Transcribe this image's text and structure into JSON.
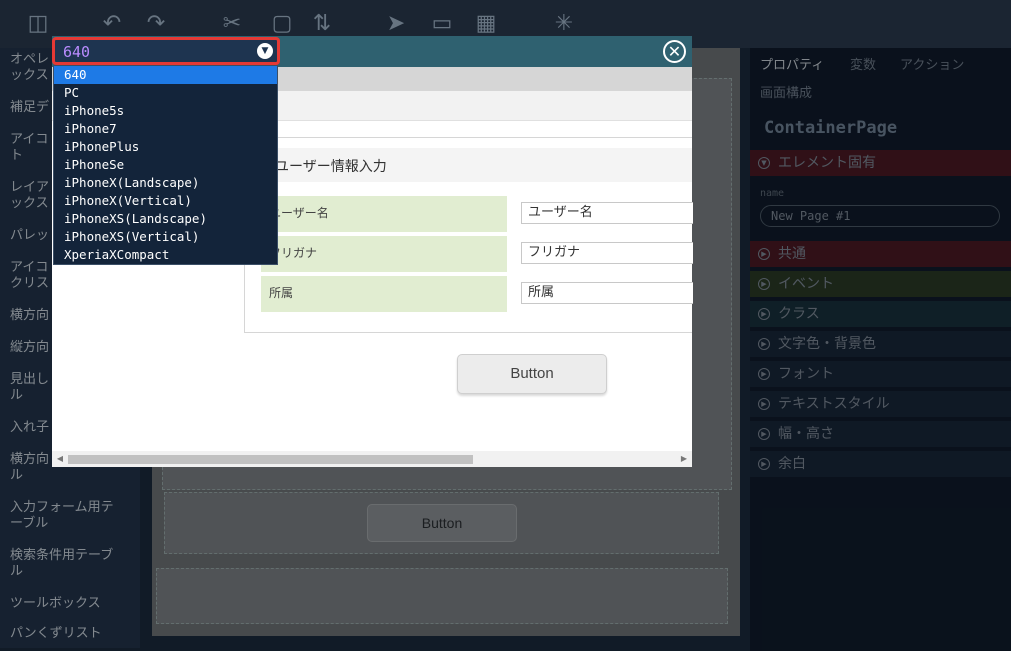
{
  "colors": {
    "modal_header": "#2f6170",
    "dropdown_bg": "#13243a",
    "dropdown_selected": "#1e7ae6",
    "select_border": "#e53935",
    "select_value": "#b98cff",
    "form_label_bg": "#e1edd1",
    "section_active": "#5a1e2a"
  },
  "toolbar": {
    "icons": [
      "database-icon",
      "undo-icon",
      "redo-icon",
      "cut-icon",
      "copy-icon",
      "paste-icon",
      "pointer-icon",
      "monitor-icon",
      "css-icon",
      "sparkle-icon"
    ]
  },
  "left_sidebar": {
    "items": [
      "オペレ\nックス",
      "補足デ",
      "アイコ\nト",
      "レイア\nックス",
      "パレッ",
      "アイコ\nクリス",
      "横方向",
      "縦方向",
      "見出し\nル",
      "入れ子",
      "横方向\nル",
      "入力フォーム用テ\nーブル",
      "検索条件用テーブ\nル",
      "ツールボックス",
      "パンくずリスト"
    ]
  },
  "canvas": {
    "button_label": "Button"
  },
  "right_panel": {
    "tabs": [
      "プロパティ",
      "変数",
      "アクション",
      "画面構成"
    ],
    "component_title": "ContainerPage",
    "element_section": "エレメント固有",
    "name_label": "name",
    "name_value": "New Page #1",
    "sections": [
      "共通",
      "イベント",
      "クラス",
      "文字色・背景色",
      "フォント",
      "テキストスタイル",
      "幅・高さ",
      "余白"
    ]
  },
  "modal": {
    "close_icon": "close-icon",
    "form_title": "ユーザー情報入力",
    "rows": [
      {
        "label": "ユーザー名",
        "value": "ユーザー名"
      },
      {
        "label": "フリガナ",
        "value": "フリガナ"
      },
      {
        "label": "所属",
        "value": "所属"
      }
    ],
    "button_label": "Button"
  },
  "device_select": {
    "selected": "640",
    "options": [
      "640",
      "PC",
      "iPhone5s",
      "iPhone7",
      "iPhonePlus",
      "iPhoneSe",
      "iPhoneX(Landscape)",
      "iPhoneX(Vertical)",
      "iPhoneXS(Landscape)",
      "iPhoneXS(Vertical)",
      "XperiaXCompact"
    ]
  }
}
